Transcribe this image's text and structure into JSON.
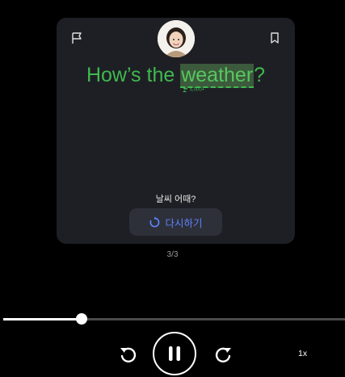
{
  "card": {
    "sentence_before": "How’s the ",
    "sentence_highlight": "weather",
    "sentence_after": "?",
    "users_count": "5,000+",
    "translation": "날씨 어때?",
    "retry_label": "다시하기"
  },
  "pagination": {
    "label": "3/3"
  },
  "player": {
    "progress": 0.23,
    "speed_label": "1x"
  },
  "colors": {
    "accent_green": "#3fb950",
    "retry_blue": "#5d82ff",
    "card_bg": "#1e1f24"
  },
  "icons": [
    "flag-icon",
    "bookmark-icon",
    "avatar",
    "users-icon",
    "replay-icon",
    "replay-back-icon",
    "pause-icon",
    "replay-forward-icon"
  ]
}
